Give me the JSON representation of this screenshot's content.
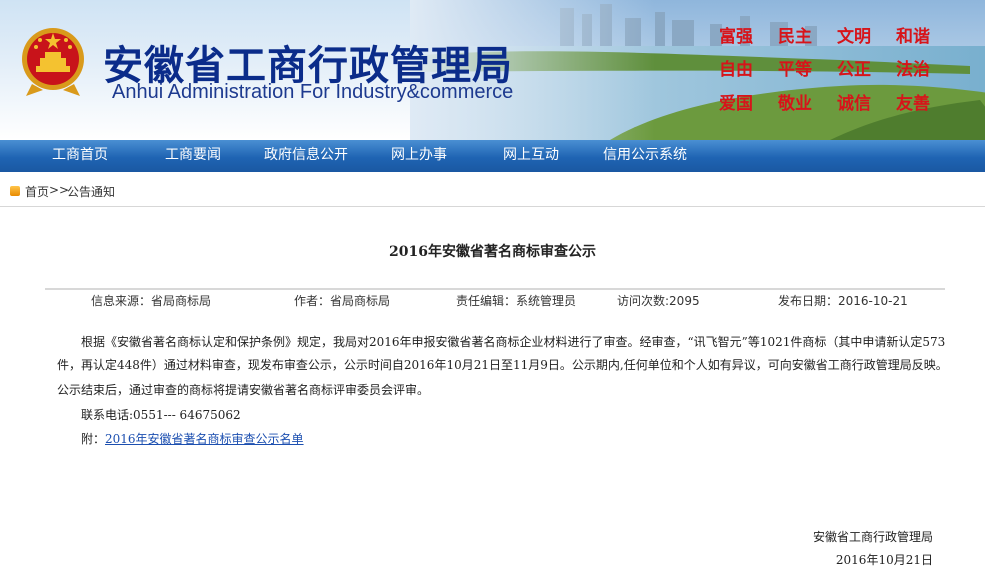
{
  "header": {
    "title_cn": "安徽省工商行政管理局",
    "title_en": "Anhui Administration For Industry&commerce",
    "slogans": [
      "富强",
      "民主",
      "文明",
      "和谐",
      "自由",
      "平等",
      "公正",
      "法治",
      "爱国",
      "敬业",
      "诚信",
      "友善"
    ]
  },
  "nav": {
    "items": [
      {
        "label": "工商首页"
      },
      {
        "label": "工商要闻"
      },
      {
        "label": "政府信息公开"
      },
      {
        "label": "网上办事"
      },
      {
        "label": "网上互动"
      },
      {
        "label": "信用公示系统"
      }
    ]
  },
  "breadcrumb": {
    "home": "首页",
    "separator": ">>",
    "current": "公告通知"
  },
  "article": {
    "title": "2016年安徽省著名商标审查公示",
    "meta": {
      "source": "信息来源：省局商标局",
      "author": "作者：省局商标局",
      "editor": "责任编辑：系统管理员",
      "views": "访问次数:2095",
      "date": "发布日期：2016-10-21"
    },
    "body": {
      "line1": "根据《安徽省著名商标认定和保护条例》规定，我局对2016年申报安徽省著名商标企业材料进行了审查。经审查，“讯飞智元”等1021件商标（其中申请新认定573",
      "line2": "件，再认定448件）通过材料审查，现发布审查公示，公示时间自2016年10月21日至11月9日。公示期内,任何单位和个人如有异议，可向安徽省工商行政管理局反映。",
      "line3": "公示结束后，通过审查的商标将提请安徽省著名商标评审委员会评审。"
    },
    "contact": "联系电话:0551--- 64675062",
    "attachment_prefix": "附：",
    "attachment_link": "2016年安徽省著名商标审查公示名单",
    "signature": "安徽省工商行政管理局",
    "sign_date": "2016年10月21日"
  },
  "colors": {
    "nav_bg": "#1f64b3",
    "title_blue": "#0b2c8a",
    "slogan_red": "#d7141a",
    "link": "#1c4fb0"
  }
}
